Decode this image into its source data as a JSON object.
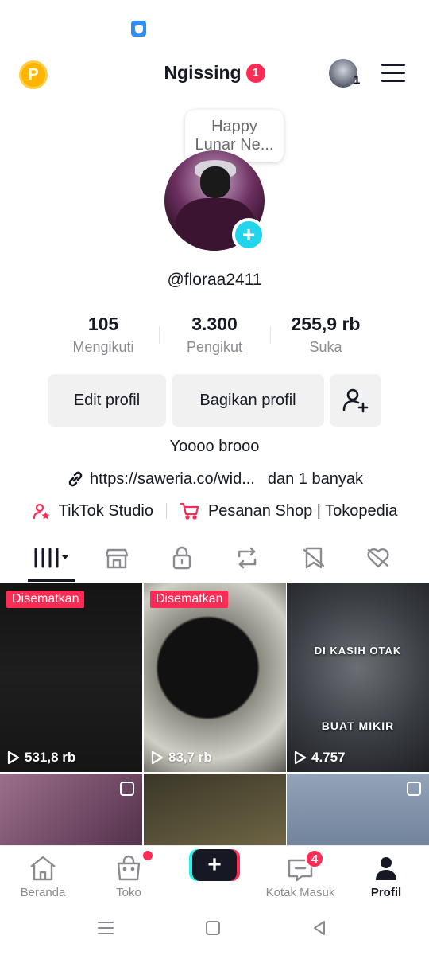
{
  "header": {
    "coin_letter": "P",
    "title": "Ngissing",
    "title_badge": "1",
    "account_count": "1"
  },
  "profile": {
    "note": "Happy\nLunar Ne...",
    "username": "@floraa2411",
    "bio": "Yoooo brooo",
    "link": "https://saweria.co/wid...",
    "link_more": "dan 1 banyak",
    "studio": "TikTok Studio",
    "shop": "Pesanan Shop | Tokopedia"
  },
  "stats": [
    {
      "value": "105",
      "label": "Mengikuti"
    },
    {
      "value": "3.300",
      "label": "Pengikut"
    },
    {
      "value": "255,9 rb",
      "label": "Suka"
    }
  ],
  "buttons": {
    "edit": "Edit profil",
    "share": "Bagikan profil"
  },
  "tabs": [
    {
      "icon": "videos-grid-icon"
    },
    {
      "icon": "shop-icon"
    },
    {
      "icon": "lock-icon"
    },
    {
      "icon": "repost-icon"
    },
    {
      "icon": "bookmark-icon"
    },
    {
      "icon": "liked-hidden-icon"
    }
  ],
  "videos": [
    {
      "pinned_label": "Disematkan",
      "views": "531,8 rb"
    },
    {
      "pinned_label": "Disematkan",
      "views": "83,7 rb"
    },
    {
      "overlay_top": "DI KASIH OTAK",
      "overlay_bottom": "BUAT MIKIR",
      "views": "4.757"
    }
  ],
  "nav": {
    "home": "Beranda",
    "shop": "Toko",
    "inbox": "Kotak Masuk",
    "inbox_badge": "4",
    "profile": "Profil"
  },
  "colors": {
    "accent": "#fe2c55",
    "cyan": "#25f4ee",
    "text": "#161823",
    "muted": "#8a8b91"
  }
}
